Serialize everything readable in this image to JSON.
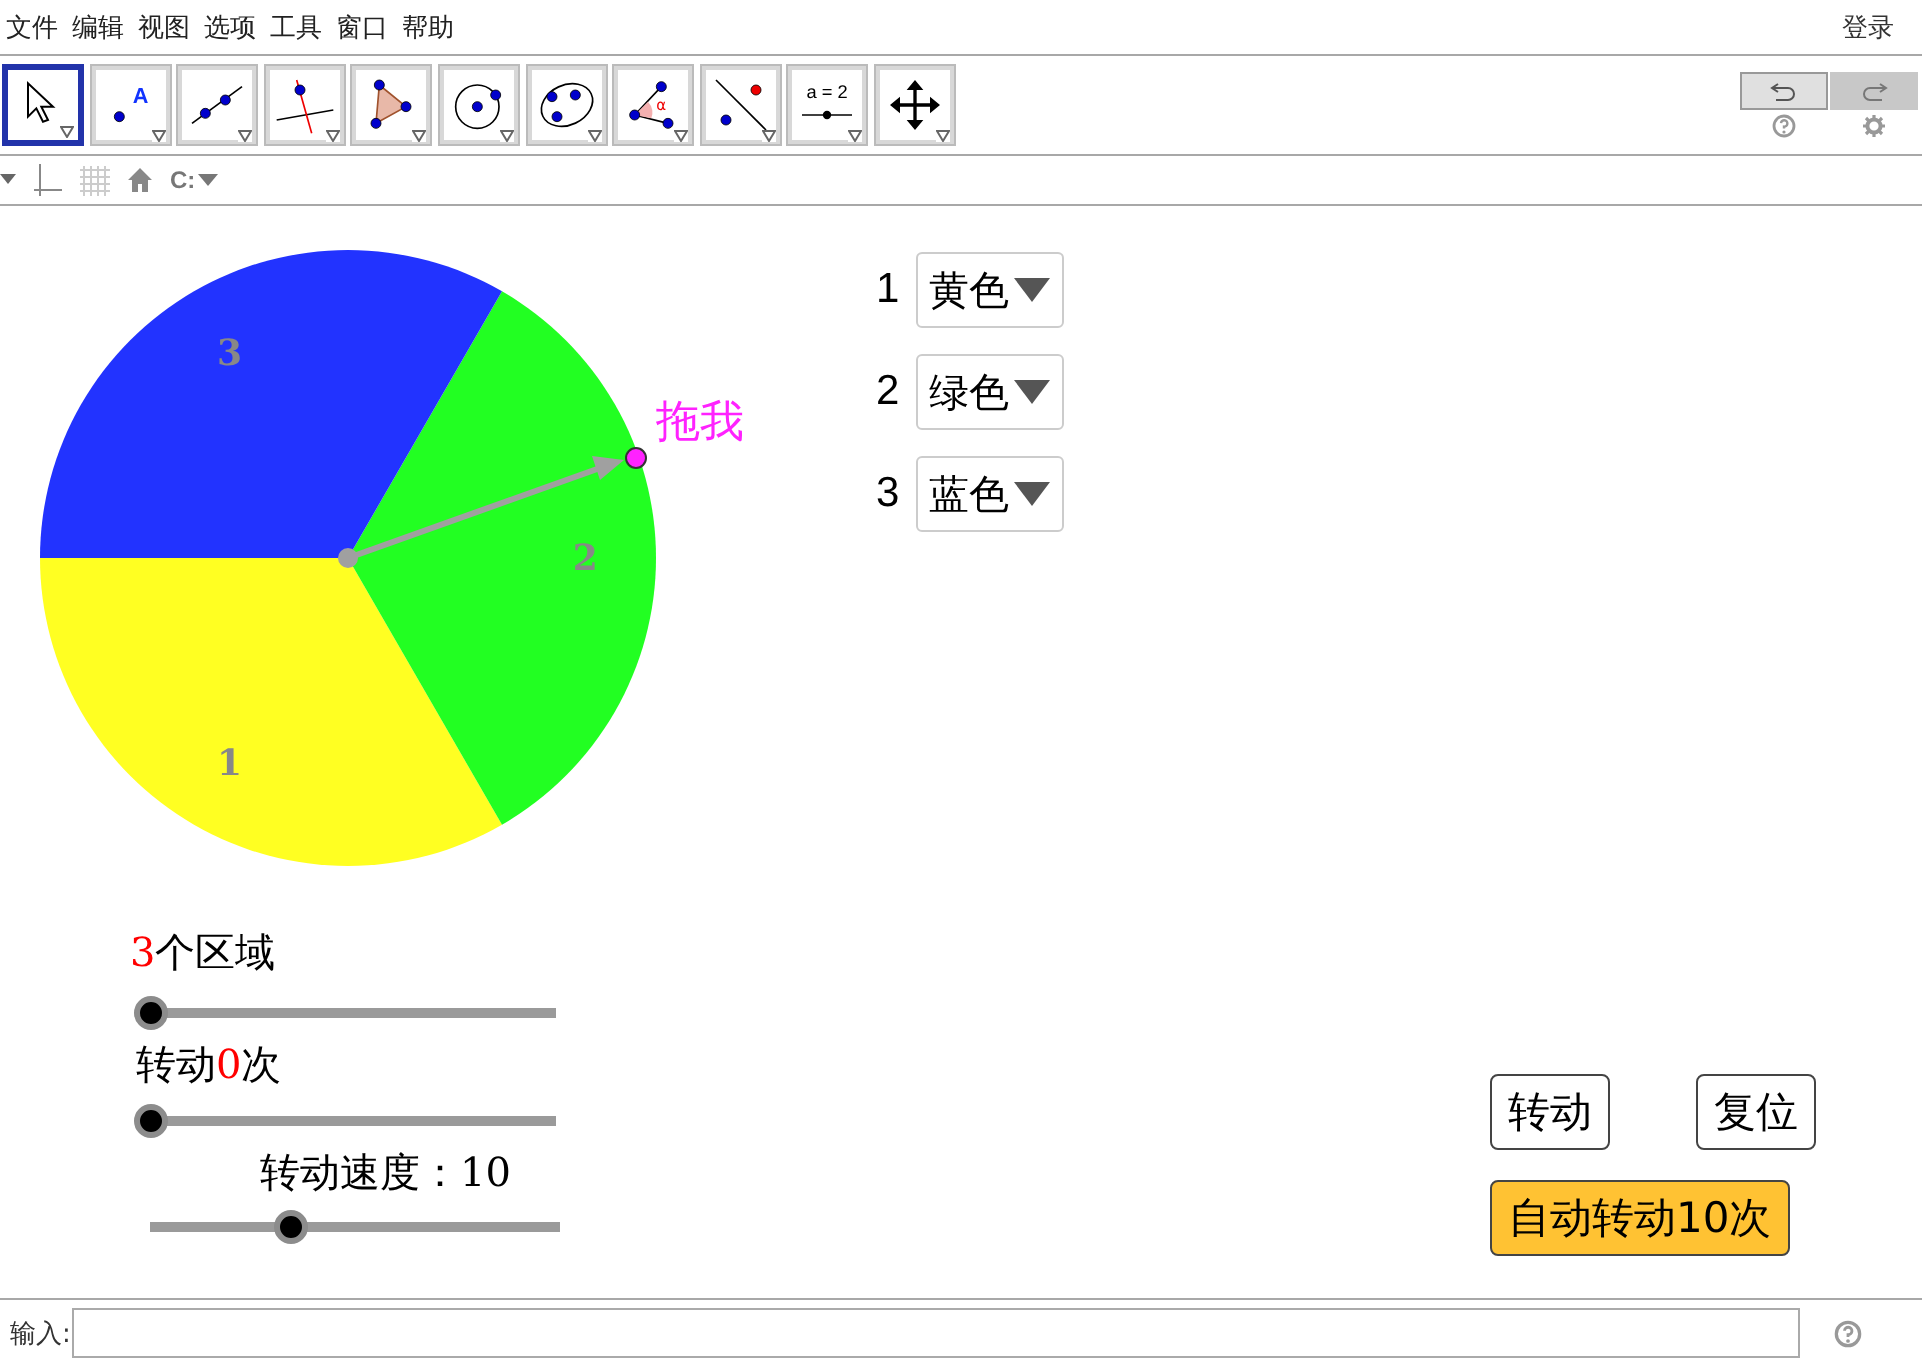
{
  "menubar": {
    "items": [
      "文件",
      "编辑",
      "视图",
      "选项",
      "工具",
      "窗口",
      "帮助"
    ],
    "login": "登录"
  },
  "toolbar": {
    "tools": [
      {
        "kind": "move",
        "selected": true
      },
      {
        "kind": "point",
        "label": "A",
        "selected": false
      },
      {
        "kind": "line",
        "selected": false
      },
      {
        "kind": "perpendicular",
        "selected": false
      },
      {
        "kind": "polygon",
        "selected": false
      },
      {
        "kind": "circle",
        "selected": false
      },
      {
        "kind": "conic",
        "selected": false
      },
      {
        "kind": "angle",
        "label": "α",
        "selected": false
      },
      {
        "kind": "reflect",
        "selected": false
      },
      {
        "kind": "slider",
        "label": "a = 2",
        "selected": false
      },
      {
        "kind": "pan",
        "selected": false
      }
    ],
    "redo_disabled": true
  },
  "stylebar": {
    "label_button": "C:"
  },
  "canvas": {
    "sectors": [
      {
        "label": "1",
        "color": "#ffff22"
      },
      {
        "label": "2",
        "color": "#22ff22"
      },
      {
        "label": "3",
        "color": "#2233ff"
      }
    ],
    "drag_label": "拖我",
    "choices": [
      {
        "number": "1",
        "value": "黄色"
      },
      {
        "number": "2",
        "value": "绿色"
      },
      {
        "number": "3",
        "value": "蓝色"
      }
    ],
    "sliders": [
      {
        "value": "3",
        "suffix": "个区域",
        "level": 0
      },
      {
        "prefix": "转动",
        "value": "0",
        "suffix": "次",
        "level": 0
      },
      {
        "prefix": "转动速度：10",
        "level": 0.34
      }
    ],
    "buttons": [
      {
        "label": "转动",
        "kind": "plain"
      },
      {
        "label": "复位",
        "kind": "plain"
      },
      {
        "label": "自动转动10次",
        "kind": "highlight"
      }
    ]
  },
  "input_bar": {
    "label": "输入:"
  }
}
